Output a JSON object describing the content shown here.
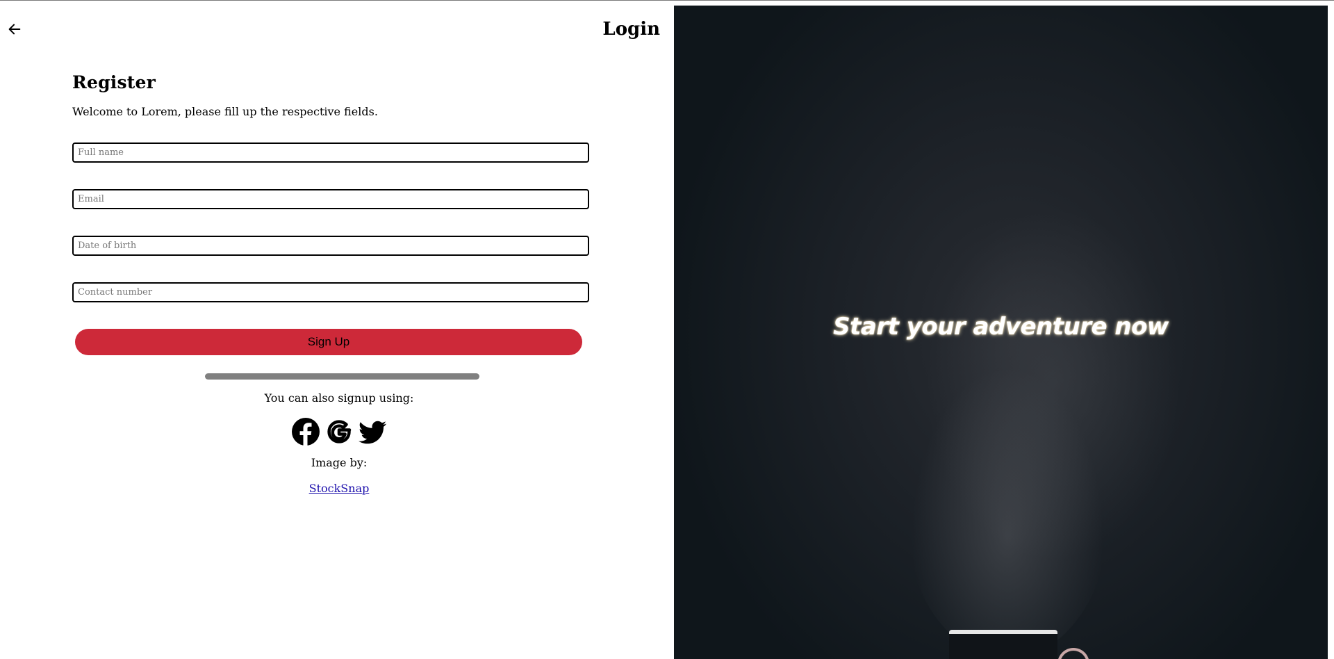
{
  "header": {
    "login_label": "Login"
  },
  "form": {
    "title": "Register",
    "subtitle": "Welcome to Lorem, please fill up the respective fields.",
    "fields": [
      {
        "placeholder": "Full name",
        "value": ""
      },
      {
        "placeholder": "Email",
        "value": ""
      },
      {
        "placeholder": "Date of birth",
        "value": ""
      },
      {
        "placeholder": "Contact number",
        "value": ""
      }
    ],
    "signup_label": "Sign Up",
    "alt_signup_text": "You can also signup using:",
    "socials": [
      "facebook-icon",
      "google-icon",
      "twitter-icon"
    ],
    "image_credit_label": "Image by:",
    "image_credit_link": "StockSnap"
  },
  "hero": {
    "tagline": "Start your adventure now"
  },
  "colors": {
    "accent": "#cd2939",
    "divider": "#808080",
    "link": "#1a0dab"
  }
}
